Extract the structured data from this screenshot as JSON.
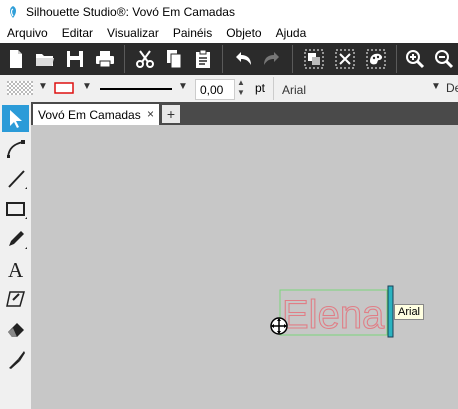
{
  "window": {
    "title": "Silhouette Studio®: Vovó Em Camadas"
  },
  "menu": [
    "Arquivo",
    "Editar",
    "Visualizar",
    "Painéis",
    "Objeto",
    "Ajuda"
  ],
  "toolbar": {
    "icons": [
      "new-file-icon",
      "open-folder-icon",
      "save-icon",
      "print-icon",
      "cut-icon",
      "copy-icon",
      "paste-icon",
      "undo-icon",
      "redo-icon",
      "group-icon",
      "ungroup-icon",
      "release-compound-icon",
      "zoom-in-icon",
      "zoom-out-icon"
    ]
  },
  "properties": {
    "line_width_value": "0,00",
    "line_width_unit": "pt",
    "font_name": "Arial",
    "next_label": "De"
  },
  "left_tools": [
    "select-icon",
    "edit-points-icon",
    "line-icon",
    "rectangle-icon",
    "pencil-icon",
    "text-icon",
    "eraser-icon",
    "knife-icon"
  ],
  "document_tab": {
    "label": "Vovó Em Camadas",
    "close": "×",
    "add": "+"
  },
  "canvas": {
    "text_object": "Elena",
    "text_color": "#e07e86",
    "tooltip": "Arial"
  }
}
